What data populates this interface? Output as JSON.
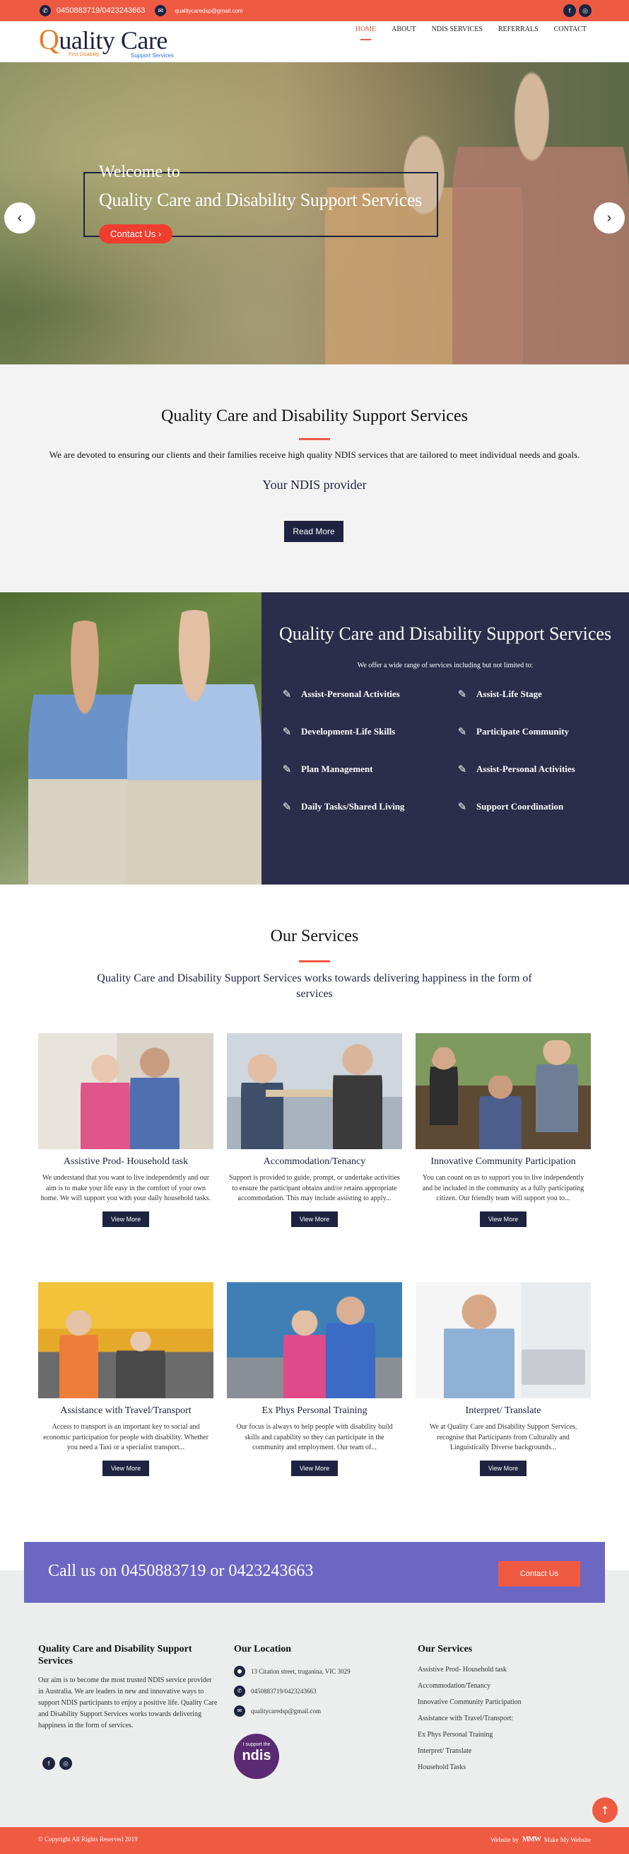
{
  "topbar": {
    "phone": "0450883719/0423243663",
    "email": "qualitycaredsp@gmail.com",
    "phone_icon": "phone-icon",
    "email_icon": "envelope-icon",
    "social": [
      {
        "icon": "facebook-icon",
        "glyph": "f"
      },
      {
        "icon": "instagram-icon",
        "glyph": "◎"
      }
    ],
    "bg_color": "#ef5a43"
  },
  "header": {
    "logo_q": "Q",
    "logo_rest": "uality Care",
    "logo_tagline_left": "First Disability",
    "logo_tagline_right": "Support Services",
    "nav": [
      "HOME",
      "ABOUT",
      "NDIS SERVICES",
      "REFERRALS",
      "CONTACT"
    ],
    "active_nav": "HOME"
  },
  "hero": {
    "welcome": "Welcome to",
    "title": "Quality Care and Disability Support Services",
    "cta": "Contact Us  ›",
    "prev": "‹",
    "next": "›"
  },
  "intro": {
    "title": "Quality Care and Disability Support Services",
    "text": "We are devoted to ensuring our clients and their families receive high quality NDIS services that are tailored to meet individual needs and goals.",
    "subtitle": "Your NDIS provider",
    "button": "Read More"
  },
  "features": {
    "title": "Quality Care and Disability Support Services",
    "subtitle": "We offer a wide range of services including but not limited to:",
    "items": [
      "Assist-Personal Activities",
      "Assist-Life Stage",
      "Development-Life Skills",
      "Participate Community",
      "Plan Management",
      "Assist-Personal Activities",
      "Daily Tasks/Shared Living",
      "Support Coordination"
    ],
    "panel_color": "#2b2d4a"
  },
  "services": {
    "title": "Our Services",
    "lead": "Quality Care and Disability Support Services works towards delivering happiness in the form of services",
    "view_more": "View More",
    "cards": [
      {
        "title": "Assistive Prod- Household task",
        "text": "We understand that you want to live independently and our aim is to make your life easy in the comfort of your own home. We will support you with your daily household tasks."
      },
      {
        "title": "Accommodation/Tenancy",
        "text": "Support is provided to guide, prompt, or undertake activities to ensure the participant obtains and/or retains appropriate accommodation. This may include assisting to apply..."
      },
      {
        "title": "Innovative Community Participation",
        "text": "You can count on us to support you to live independently and be included in the community as a fully participating citizen. Our friendly team will support you to..."
      },
      {
        "title": "Assistance with Travel/Transport",
        "text": "Access to transport is an important key to social and economic participation for people with disability. Whether you need a Taxi or a specialist transport..."
      },
      {
        "title": "Ex Phys Personal Training",
        "text": "Our focus is always to help people with disability build skills and capability so they can participate in the community and employment. Our team of..."
      },
      {
        "title": "Interpret/ Translate",
        "text": "We at Quality Care and Disability Support Services, recognise that Participants from Culturally and Linguistically Diverse backgrounds..."
      }
    ]
  },
  "callband": {
    "text": "Call us on 0450883719 or 0423243663",
    "button": "Contact Us",
    "color": "#6d67c4"
  },
  "footer": {
    "about_title": "Quality Care and Disability Support Services",
    "about_text": "Our aim is to become the most trusted NDIS service provider in Australia. We are leaders in new and innovative ways to support NDIS participants to enjoy a positive life. Quality Care and Disability Support Services works towards delivering happiness in the form of services.",
    "location_title": "Our Location",
    "address": "13 Citation street, truganina, VIC 3029",
    "phone": "0450883719/0423243663",
    "email": "qualitycaredsp@gmail.com",
    "ndis_line1": "I support the",
    "ndis_line2": "ndis",
    "services_title": "Our Services",
    "services": [
      "Assistive Prod- Household task",
      "Accommodation/Tenancy",
      "Innovative Community Participation",
      "Assistance with Travel/Transport:",
      "Ex Phys Personal Training",
      "Interpret/ Translate",
      "Household Tasks"
    ],
    "copyright": "© Copyright All Rights Reserved 2019",
    "website_by": "Website by",
    "maker": "Make My Website",
    "maker_logo": "MMW",
    "to_top": "↑"
  }
}
